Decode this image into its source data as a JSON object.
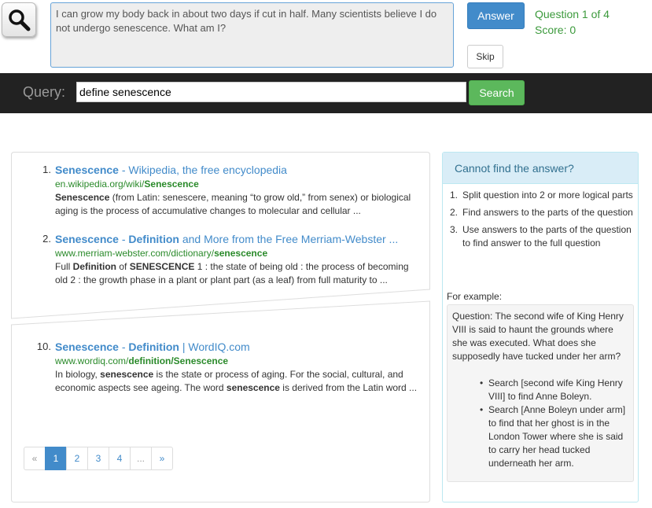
{
  "question": {
    "text": "I can grow my body back in about two days if cut in half. Many scientists believe I do not undergo senescence. What am I?"
  },
  "buttons": {
    "answer_label": "Answer",
    "skip_label": "Skip"
  },
  "status": {
    "progress": "Question 1 of 4",
    "score": "Score: 0"
  },
  "query": {
    "label": "Query:",
    "value": "define senescence",
    "search_label": "Search"
  },
  "results": [
    {
      "num": "1.",
      "title_bold": "Senescence",
      "title_rest": " - Wikipedia, the free encyclopedia",
      "url_plain": "en.wikipedia.org/wiki/",
      "url_bold": "Senescence",
      "snippet_html": "<b>Senescence</b> (from Latin: senescere, meaning “to grow old,” from senex) or biological aging is the process of accumulative changes to molecular and cellular ..."
    },
    {
      "num": "2.",
      "title_bold": "Senescence",
      "title_rest": " - <b>Definition</b> and More from the Free Merriam-Webster ...",
      "url_plain": "www.merriam-webster.com/dictionary/",
      "url_bold": "senescence",
      "snippet_html": "Full <b>Definition</b> of <b>SENESCENCE</b> 1 : the state of being old : the process of becoming old 2 : the growth phase in a plant or plant part (as a leaf) from full maturity to ..."
    },
    {
      "num": "10.",
      "title_bold": "Senescence",
      "title_rest": " - <b>Definition</b> | WordIQ.com",
      "url_plain": "www.wordiq.com/",
      "url_bold": "definition/Senescence",
      "snippet_html": "In biology, <b>senescence</b> is the state or process of aging. For the social, cultural, and economic aspects see ageing. The word <b>senescence</b> is derived from the Latin word ..."
    }
  ],
  "pagination": [
    "«",
    "1",
    "2",
    "3",
    "4",
    "...",
    "»"
  ],
  "help": {
    "title": "Cannot find the answer?",
    "steps": [
      "Split question into 2 or more logical parts",
      "Find answers to the parts of the question",
      "Use answers to the parts of the question to find answer to the full question"
    ],
    "example_label": "For example:",
    "example_question": "Question: The second wife of King Henry VIII is said to haunt the grounds where she was executed. What does she supposedly have tucked under her arm?",
    "example_items": [
      "Search [second wife King Henry VIII] to find Anne Boleyn.",
      "Search [Anne Boleyn under arm] to find that her ghost is in the London Tower where she is said to carry her head tucked underneath her arm."
    ]
  },
  "colors": {
    "primary": "#428bca",
    "success": "#5cb85c",
    "status_green": "#3c9a3c",
    "url_green": "#2a8a2a",
    "query_bar": "#222222",
    "info_bg": "#d9edf7"
  }
}
